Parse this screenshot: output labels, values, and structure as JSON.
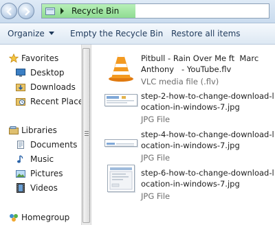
{
  "address": {
    "location": "Recycle Bin"
  },
  "commands": {
    "organize": "Organize",
    "empty": "Empty the Recycle Bin",
    "restore": "Restore all items"
  },
  "nav": {
    "favorites": "Favorites",
    "desktop": "Desktop",
    "downloads": "Downloads",
    "recent": "Recent Places",
    "libraries": "Libraries",
    "documents": "Documents",
    "music": "Music",
    "pictures": "Pictures",
    "videos": "Videos",
    "homegroup": "Homegroup"
  },
  "files": [
    {
      "name": "Pitbull - Rain Over Me ft  Marc\nAnthony   - YouTube.flv",
      "type": "VLC media file (.flv)",
      "icon": "vlc-icon"
    },
    {
      "name": "step-2-how-to-change-download-l\nocation-in-windows-7.jpg",
      "type": "JPG File",
      "icon": "jpg-thumbnail"
    },
    {
      "name": "step-4-how-to-change-download-l\nocation-in-windows-7.jpg",
      "type": "JPG File",
      "icon": "jpg-thumbnail"
    },
    {
      "name": "step-6-how-to-change-download-l\nocation-in-windows-7.jpg",
      "type": "JPG File",
      "icon": "jpg-thumbnail"
    }
  ]
}
